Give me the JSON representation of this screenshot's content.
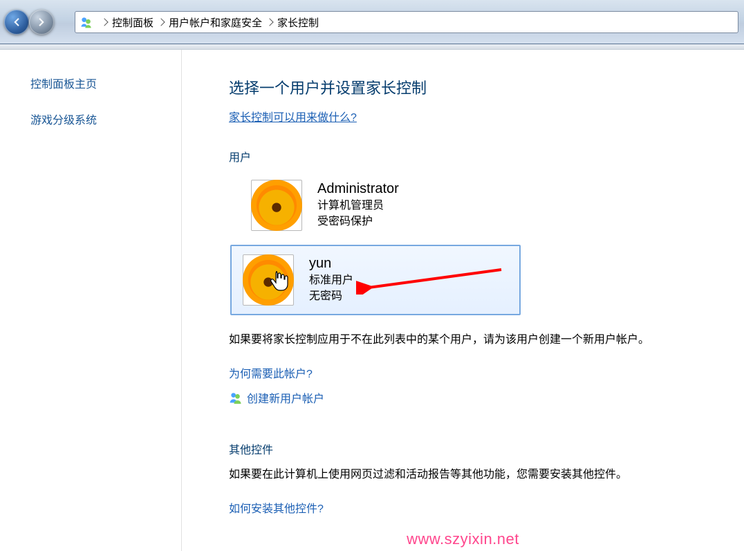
{
  "breadcrumb": {
    "root": "控制面板",
    "level1": "用户帐户和家庭安全",
    "level2": "家长控制"
  },
  "sidebar": {
    "home": "控制面板主页",
    "rating": "游戏分级系统"
  },
  "main": {
    "title": "选择一个用户并设置家长控制",
    "help_link": "家长控制可以用来做什么?",
    "users_heading": "用户",
    "users": [
      {
        "name": "Administrator",
        "role": "计算机管理员",
        "status": "受密码保护"
      },
      {
        "name": "yun",
        "role": "标准用户",
        "status": "无密码"
      }
    ],
    "note": "如果要将家长控制应用于不在此列表中的某个用户，请为该用户创建一个新用户帐户。",
    "why_link": "为何需要此帐户?",
    "create_link": "创建新用户帐户",
    "other_heading": "其他控件",
    "other_note": "如果要在此计算机上使用网页过滤和活动报告等其他功能，您需要安装其他控件。",
    "how_link": "如何安装其他控件?"
  },
  "watermark": "www.szyixin.net"
}
